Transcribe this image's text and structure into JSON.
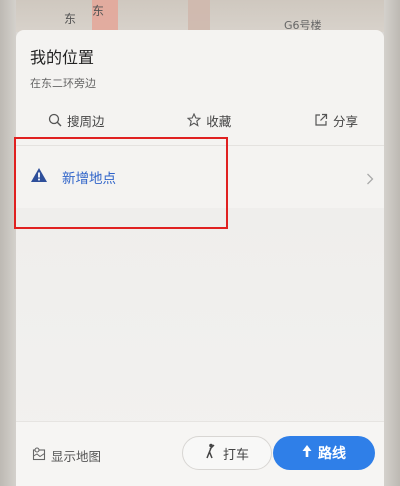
{
  "map": {
    "labels": [
      "东",
      "东",
      "G6号楼"
    ]
  },
  "header": {
    "title": "我的位置",
    "subtitle": "在东二环旁边"
  },
  "actions": [
    {
      "label": "搜周边",
      "icon": "search-icon"
    },
    {
      "label": "收藏",
      "icon": "star-icon"
    },
    {
      "label": "分享",
      "icon": "share-icon"
    }
  ],
  "new_place": {
    "label": "新增地点",
    "icon": "warning-triangle-icon"
  },
  "bottom": {
    "show_map_label": "显示地图",
    "taxi_label": "打车",
    "route_label": "路线"
  },
  "colors": {
    "accent_blue": "#2f7fe8",
    "link_blue": "#2e63c9",
    "highlight_red": "#e02020"
  }
}
